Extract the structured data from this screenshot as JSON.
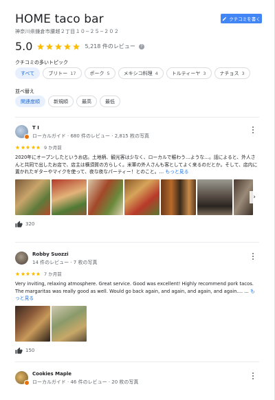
{
  "place": {
    "name": "HOME taco bar",
    "address": "神奈川県鎌倉市腰越２丁目１０−２５−２０２",
    "write_review_label": "クチコミを書く",
    "rating": "5.0",
    "review_count": "5,218 件のレビュー"
  },
  "topics": {
    "label": "クチコミの多いトピック",
    "chips": [
      {
        "label": "すべて",
        "count": ""
      },
      {
        "label": "ブリトー",
        "count": "17"
      },
      {
        "label": "ポーク",
        "count": "5"
      },
      {
        "label": "メキシコ料理",
        "count": "4"
      },
      {
        "label": "トルティーヤ",
        "count": "3"
      },
      {
        "label": "ナチョス",
        "count": "3"
      }
    ]
  },
  "sort": {
    "label": "並べ替え",
    "options": [
      "関連度順",
      "新規順",
      "最高",
      "最低"
    ]
  },
  "reviews": [
    {
      "name": "T I",
      "sub": "ローカルガイド · 680 件のレビュー · 2,815 枚の写真",
      "time": "9 か月前",
      "text": "2020年にオープンしたというお店。土地柄、観光客は少なく、ローカルで賑わう…ような…。話によると、外人さんと共同で出したお店で、店主は横須賀の方らしく。米軍の外人さんも客としてよく来るのだとか。そして、店内に置かれたギターやマイクを使って、夜な夜なパーティー！とのこと。…",
      "more": "もっと見る",
      "likes": "320"
    },
    {
      "name": "Robby Suozzi",
      "sub": "14 件のレビュー · 7 枚の写真",
      "time": "7 か月前",
      "text": "Very inviting, relaxing atmosphere. Great service. Good was excellent! Highly recommend pork tacos. The margaritas was really good as well. Would go back again, and again, and again, and again.... ...",
      "more": "もっと見る",
      "likes": "150"
    },
    {
      "name": "Cookies Maple",
      "sub": "ローカルガイド · 46 件のレビュー · 20 枚の写真"
    }
  ],
  "colors": {
    "accent": "#4285f4",
    "star": "#fbbc04",
    "link": "#1a73e8",
    "chip_selected_bg": "#e8f0fe",
    "chip_selected_text": "#1967d2"
  },
  "icons": {
    "write": "pencil-icon",
    "star": "star-icon",
    "help": "help-icon",
    "more": "more-vert-icon",
    "like": "thumb-up-icon",
    "next": "chevron-right-icon"
  }
}
